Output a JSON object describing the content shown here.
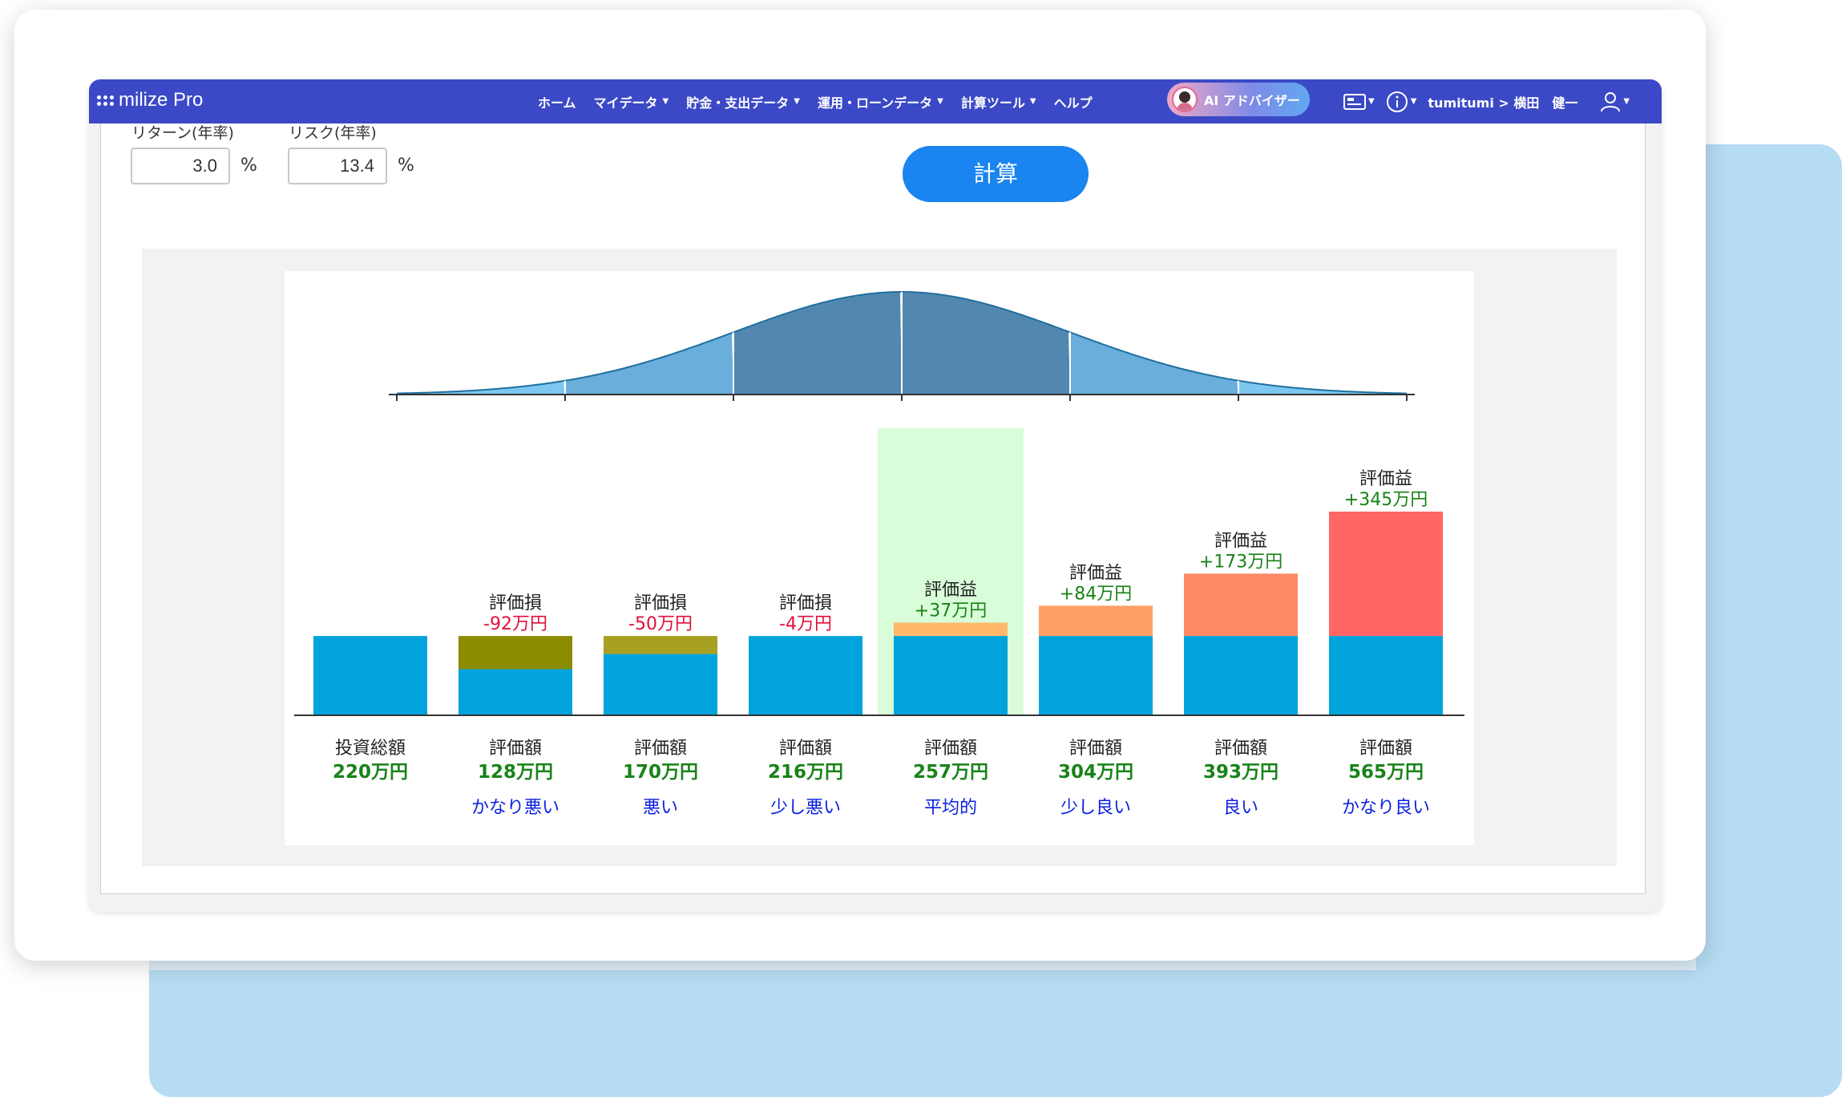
{
  "app": {
    "logo": "milize Pro"
  },
  "nav": {
    "items": [
      {
        "label": "ホーム",
        "dropdown": false
      },
      {
        "label": "マイデータ",
        "dropdown": true
      },
      {
        "label": "貯金・支出データ",
        "dropdown": true
      },
      {
        "label": "運用・ローンデータ",
        "dropdown": true
      },
      {
        "label": "計算ツール",
        "dropdown": true
      },
      {
        "label": "ヘルプ",
        "dropdown": false
      }
    ],
    "ai_button": "AI アドバイザー",
    "breadcrumb_user": "tumitumi > 横田　健一",
    "icons": [
      "id-card-icon",
      "info-icon",
      "user-icon"
    ]
  },
  "form": {
    "return_label": "リターン(年率)",
    "return_value": "3.0",
    "risk_label": "リスク(年率)",
    "risk_value": "13.4",
    "percent": "%",
    "calc_button": "計算"
  },
  "colors": {
    "nav": "#3b49c6",
    "base_bar": "#00a3dc",
    "label_green": "#188318",
    "loss_red": "#e0103a",
    "scenario_blue": "#0a1fe0",
    "highlight": "#d8fdd8"
  },
  "chart_data": {
    "type": "bar",
    "categories": [
      "投資総額",
      "かなり悪い",
      "悪い",
      "少し悪い",
      "平均的",
      "少し良い",
      "良い",
      "かなり良い"
    ],
    "total_label": "投資総額",
    "value_label": "評価額",
    "unit": "万円",
    "investment_total": 220,
    "values": [
      220,
      128,
      170,
      216,
      257,
      304,
      393,
      565
    ],
    "value_texts": [
      "220万円",
      "128万円",
      "170万円",
      "216万円",
      "257万円",
      "304万円",
      "393万円",
      "565万円"
    ],
    "gains": [
      null,
      -92,
      -50,
      -4,
      37,
      84,
      173,
      345
    ],
    "gain_labels": [
      null,
      "評価損",
      "評価損",
      "評価損",
      "評価益",
      "評価益",
      "評価益",
      "評価益"
    ],
    "gain_texts": [
      null,
      "-92万円",
      "-50万円",
      "-4万円",
      "+37万円",
      "+84万円",
      "+173万円",
      "+345万円"
    ],
    "gain_colors": [
      null,
      "#8b8b00",
      "#a8a020",
      "#00a3dc",
      "#ffb86a",
      "#ffa066",
      "#ff8a66",
      "#ff6666"
    ],
    "scenario_labels": [
      "",
      "かなり悪い",
      "悪い",
      "少し悪い",
      "平均的",
      "少し良い",
      "良い",
      "かなり良い"
    ],
    "highlight_category": "平均的",
    "distribution": {
      "type": "normal",
      "sections": 6,
      "center_index": 3
    }
  }
}
